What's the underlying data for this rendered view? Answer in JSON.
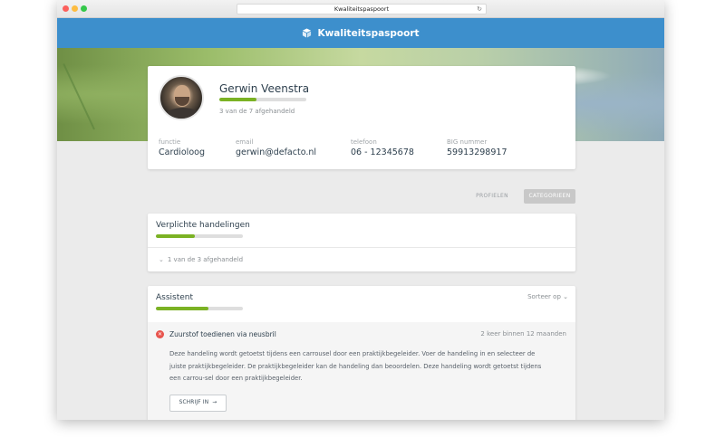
{
  "browser": {
    "url": "Kwaliteitspaspoort",
    "reload_icon": "reload-icon"
  },
  "app": {
    "title": "Kwaliteitspaspoort",
    "logo_icon": "cube-logo-icon",
    "accent_color": "#3d8fcc",
    "progress_color": "#7bb224"
  },
  "profile": {
    "name": "Gerwin Veenstra",
    "progress_fraction": 0.43,
    "progress_text": "3 van de 7 afgehandeld",
    "fields": [
      {
        "label": "functie",
        "value": "Cardioloog"
      },
      {
        "label": "email",
        "value": "gerwin@defacto.nl"
      },
      {
        "label": "telefoon",
        "value": "06 - 12345678"
      },
      {
        "label": "BIG nummer",
        "value": "59913298917"
      }
    ]
  },
  "tabs": {
    "profielen": "PROFIELEN",
    "categorieen": "CATEGORIEEN",
    "active": "categorieen"
  },
  "sections": [
    {
      "title": "Verplichte handelingen",
      "progress_fraction": 0.45,
      "status": "1 van de 3 afgehandeld"
    },
    {
      "title": "Assistent",
      "progress_fraction": 0.6,
      "sort_label": "Sorteer op",
      "items": [
        {
          "status": "error",
          "title": "Zuurstof toedienen via neusbril",
          "meta": "2 keer binnen 12 maanden",
          "description": "Deze handeling wordt getoetst tijdens een carrousel door een praktijkbegeleider. Voer de handeling in en selecteer de juiste praktijkbegeleider. De praktijkbegeleider kan de handeling dan beoordelen. Deze handeling wordt getoetst tijdens een carrou-sel door een praktijkbegeleider.",
          "button_label": "SCHRIJF IN"
        }
      ]
    }
  ]
}
